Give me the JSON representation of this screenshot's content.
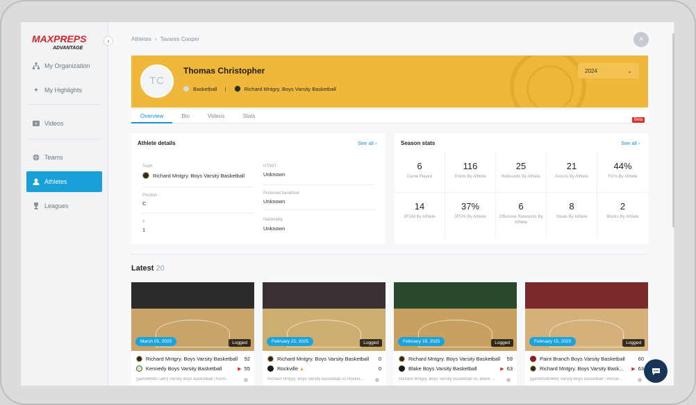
{
  "colors": {
    "accent": "#1aa0d9",
    "hero_bg": "#f0b73a",
    "win_marker": "#d9302b"
  },
  "sidebar": {
    "logo_top": "MAXPREPS",
    "logo_bottom": "ADVANTAGE",
    "collapse_icon": "chevron-left-icon",
    "items": [
      {
        "label": "My Organization",
        "icon": "org-chart-icon"
      },
      {
        "label": "My Highlights",
        "icon": "sparkle-icon"
      },
      {
        "label": "Videos",
        "icon": "video-icon"
      },
      {
        "label": "Teams",
        "icon": "basketball-icon"
      },
      {
        "label": "Athletes",
        "icon": "person-icon",
        "active": true
      },
      {
        "label": "Leagues",
        "icon": "trophy-icon"
      }
    ]
  },
  "header": {
    "breadcrumb": [
      "Athletes",
      "Tavares Cooper"
    ],
    "breadcrumb_sep": "›",
    "user_initial": "A"
  },
  "hero": {
    "initials": "TC",
    "name": "Thomas Christopher",
    "sport": "Basketball",
    "separator": "|",
    "team": "Richard Mntgry. Boys Varsity Basketball",
    "season": "2024",
    "season_chevron": "⌄"
  },
  "tabs": [
    "Overview",
    "Bio",
    "Videos",
    "Stats"
  ],
  "beta_label": "Beta",
  "athlete_details": {
    "title": "Athlete details",
    "see_all": "See all",
    "fields": {
      "team_label": "Team",
      "team_value": "Richard Mntgry. Boys Varsity Basketball",
      "htwt_label": "HT/WT",
      "htwt_value": "Unknown",
      "position_label": "Position",
      "position_value": "C",
      "hand_label": "Preferred hand/foot",
      "hand_value": "Unknown",
      "number_label": "#",
      "number_value": "1",
      "nationality_label": "Nationality",
      "nationality_value": "Unknown"
    }
  },
  "season_stats": {
    "title": "Season stats",
    "see_all": "See all",
    "cells": [
      {
        "value": "6",
        "label": "Game Played"
      },
      {
        "value": "116",
        "label": "Points By Athlete"
      },
      {
        "value": "25",
        "label": "Rebounds By Athlete"
      },
      {
        "value": "21",
        "label": "Assists By Athlete"
      },
      {
        "value": "44%",
        "label": "FG% By Athlete"
      },
      {
        "value": "14",
        "label": "3FGM By Athlete"
      },
      {
        "value": "37%",
        "label": "3FG% By Athlete"
      },
      {
        "value": "6",
        "label": "Offensive Rebounds By Athlete"
      },
      {
        "value": "8",
        "label": "Steals By Athlete"
      },
      {
        "value": "2",
        "label": "Blocks By Athlete"
      }
    ]
  },
  "latest": {
    "title": "Latest",
    "count": "20",
    "videos": [
      {
        "date": "March 05, 2025",
        "status": "Logged",
        "team1": "Richard Mntgry. Boys Varsity Basketball",
        "score1": "52",
        "team2": "Kennedy Boys Varsity Basketball",
        "score2": "55",
        "winner": 2,
        "desc": "[gamb46fdc7a60] Varsity Boys Basketball | Kenn..."
      },
      {
        "date": "February 22, 2025",
        "status": "Logged",
        "team1": "Richard Mntgry. Boys Varsity Basketball",
        "score1": "0",
        "team2": "Rockville",
        "score2": "0",
        "winner": 0,
        "desc": "Richard Mntgry. Boys Varsity Basketball vs Rockvi..."
      },
      {
        "date": "February 19, 2025",
        "status": "Logged",
        "team1": "Richard Mntgry. Boys Varsity Basketball",
        "score1": "59",
        "team2": "Blake Boys Varsity Basketball",
        "score2": "63",
        "winner": 2,
        "desc": "Richard Mntgry. Boys Varsity Basketball vs. Blake ..."
      },
      {
        "date": "February 15, 2025",
        "status": "Logged",
        "team1": "Paint Branch Boys Varsity Basketball",
        "score1": "60",
        "team2": "Richard Mntgry. Boys Varsity Bask...",
        "score2": "63",
        "winner": 2,
        "desc": "[gamd05fbf4b6] Varsity Boys Basketball | Richar..."
      }
    ]
  },
  "chat_icon": "chat-bubble-icon"
}
